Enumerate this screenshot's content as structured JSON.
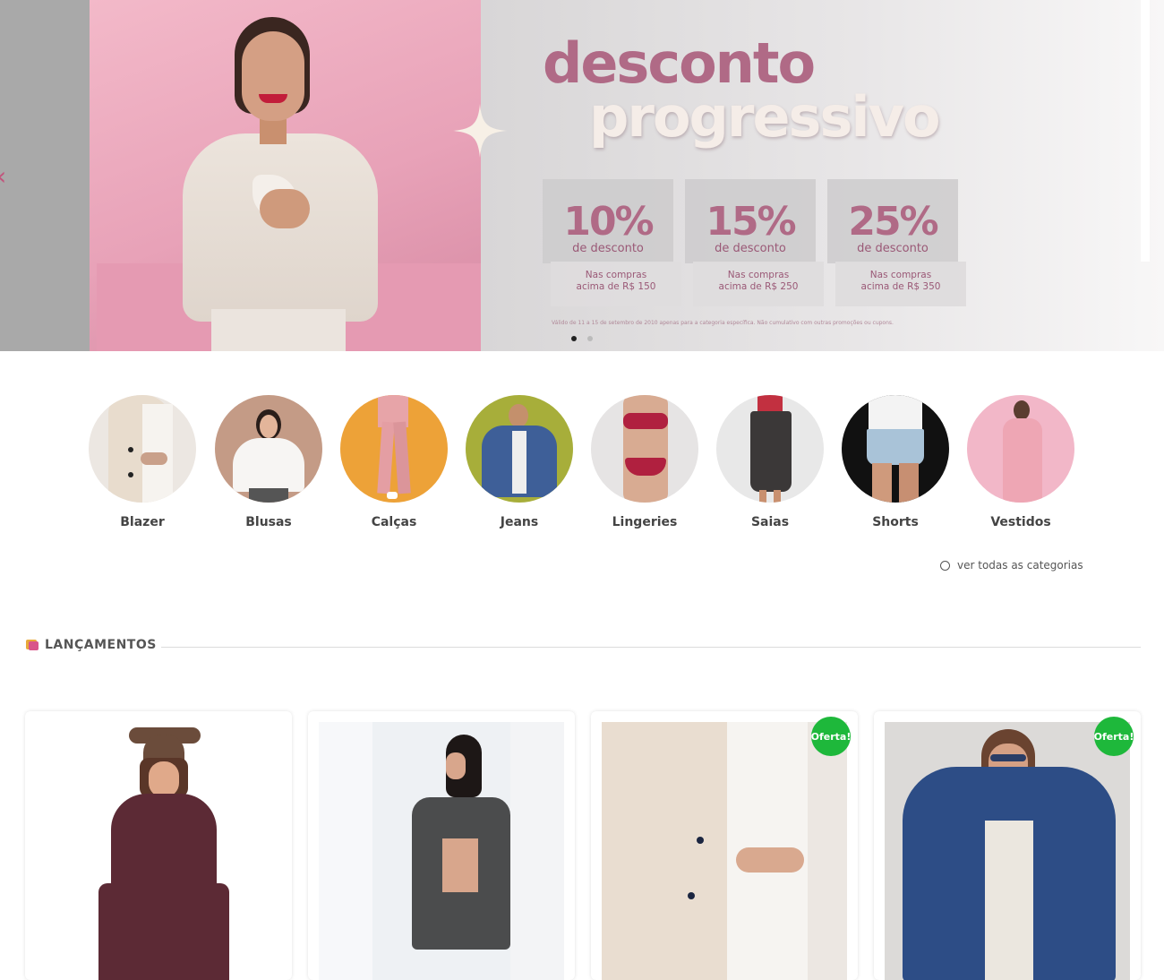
{
  "banner": {
    "title_line1": "desconto",
    "title_line2": "progressivo",
    "prev_icon": "chevron-left-icon",
    "tiers": [
      {
        "percent": "10%",
        "label": "de desconto",
        "note_line1": "Nas compras",
        "note_line2": "acima de R$ 150"
      },
      {
        "percent": "15%",
        "label": "de desconto",
        "note_line1": "Nas compras",
        "note_line2": "acima de R$ 250"
      },
      {
        "percent": "25%",
        "label": "de desconto",
        "note_line1": "Nas compras",
        "note_line2": "acima de R$ 350"
      }
    ],
    "disclaimer": "Válido de 11 a 15 de setembro de 2010 apenas para a categoria específica. Não cumulativo com outras promoções ou cupons.",
    "slides_count": 2,
    "active_slide": 1
  },
  "categories": {
    "items": [
      {
        "label": "Blazer"
      },
      {
        "label": "Blusas"
      },
      {
        "label": "Calças"
      },
      {
        "label": "Jeans"
      },
      {
        "label": "Lingeries"
      },
      {
        "label": "Saias"
      },
      {
        "label": "Shorts"
      },
      {
        "label": "Vestidos"
      }
    ],
    "see_all": "ver todas as categorias"
  },
  "launches": {
    "title": "LANÇAMENTOS",
    "offer_badge": "Oferta!",
    "products": [
      {
        "offer": false
      },
      {
        "offer": false
      },
      {
        "offer": true
      },
      {
        "offer": true
      }
    ]
  },
  "colors": {
    "brand": "#b06a86",
    "offer_green": "#1eb83b"
  }
}
